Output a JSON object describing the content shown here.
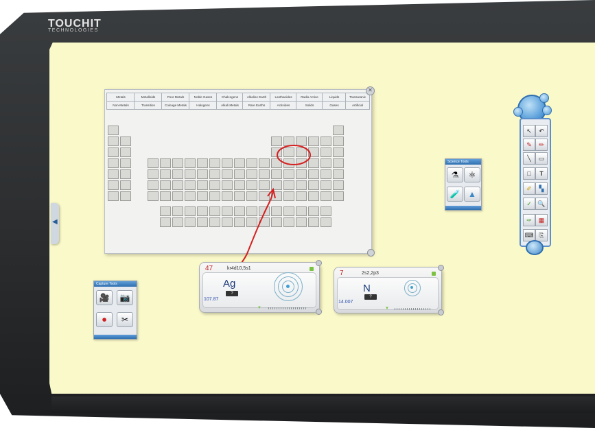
{
  "brand": {
    "logo": "TOUCHIT",
    "sub": "TECHNOLOGIES"
  },
  "periodic_table": {
    "tabs_row1": [
      "Metals",
      "Metalloids",
      "Poor Metals",
      "Noble Gases",
      "Chalcogens",
      "Alkaline Earth",
      "Lanthanides",
      "Radio Active",
      "Liquids",
      "Transuranic"
    ],
    "tabs_row2": [
      "Non-Metals",
      "Transition",
      "Coinage Metals",
      "Halogens",
      "Alkali Metals",
      "Rare Earths",
      "Actinides",
      "Solids",
      "Gases",
      "Artificial"
    ]
  },
  "cards": [
    {
      "number": "47",
      "config": "kr4d10,5s1",
      "symbol": "Ag",
      "button": "?",
      "mass": "107.87"
    },
    {
      "number": "7",
      "config": "2s2,2p3",
      "symbol": "N",
      "button": "?",
      "mass": "14.007"
    }
  ],
  "capture_tools": {
    "title": "Capture Tools"
  },
  "science_tools": {
    "title": "Science Tools"
  },
  "icons": {
    "close": "✕",
    "side_arrow": "◀",
    "video": "🎥",
    "camera": "📷",
    "record": "⏺",
    "snip": "✂",
    "beaker": "⚗",
    "molecule": "⚛",
    "flask": "🧪",
    "triangle": "▲",
    "cursor": "↖",
    "undo": "↶",
    "pen": "✎",
    "marker": "✏",
    "line": "╲",
    "eraser": "▭",
    "rect": "□",
    "text": "T",
    "highlighter": "✐",
    "fill": "▚",
    "check": "✓",
    "zoom": "🔍",
    "brush": "✑",
    "calendar": "▦",
    "keyboard": "⌨",
    "page": "⎘"
  },
  "colors": {
    "board": "#faf9c9",
    "bezel": "#2b2d2f",
    "accent": "#2f6fb0",
    "annotation": "#d42020"
  }
}
